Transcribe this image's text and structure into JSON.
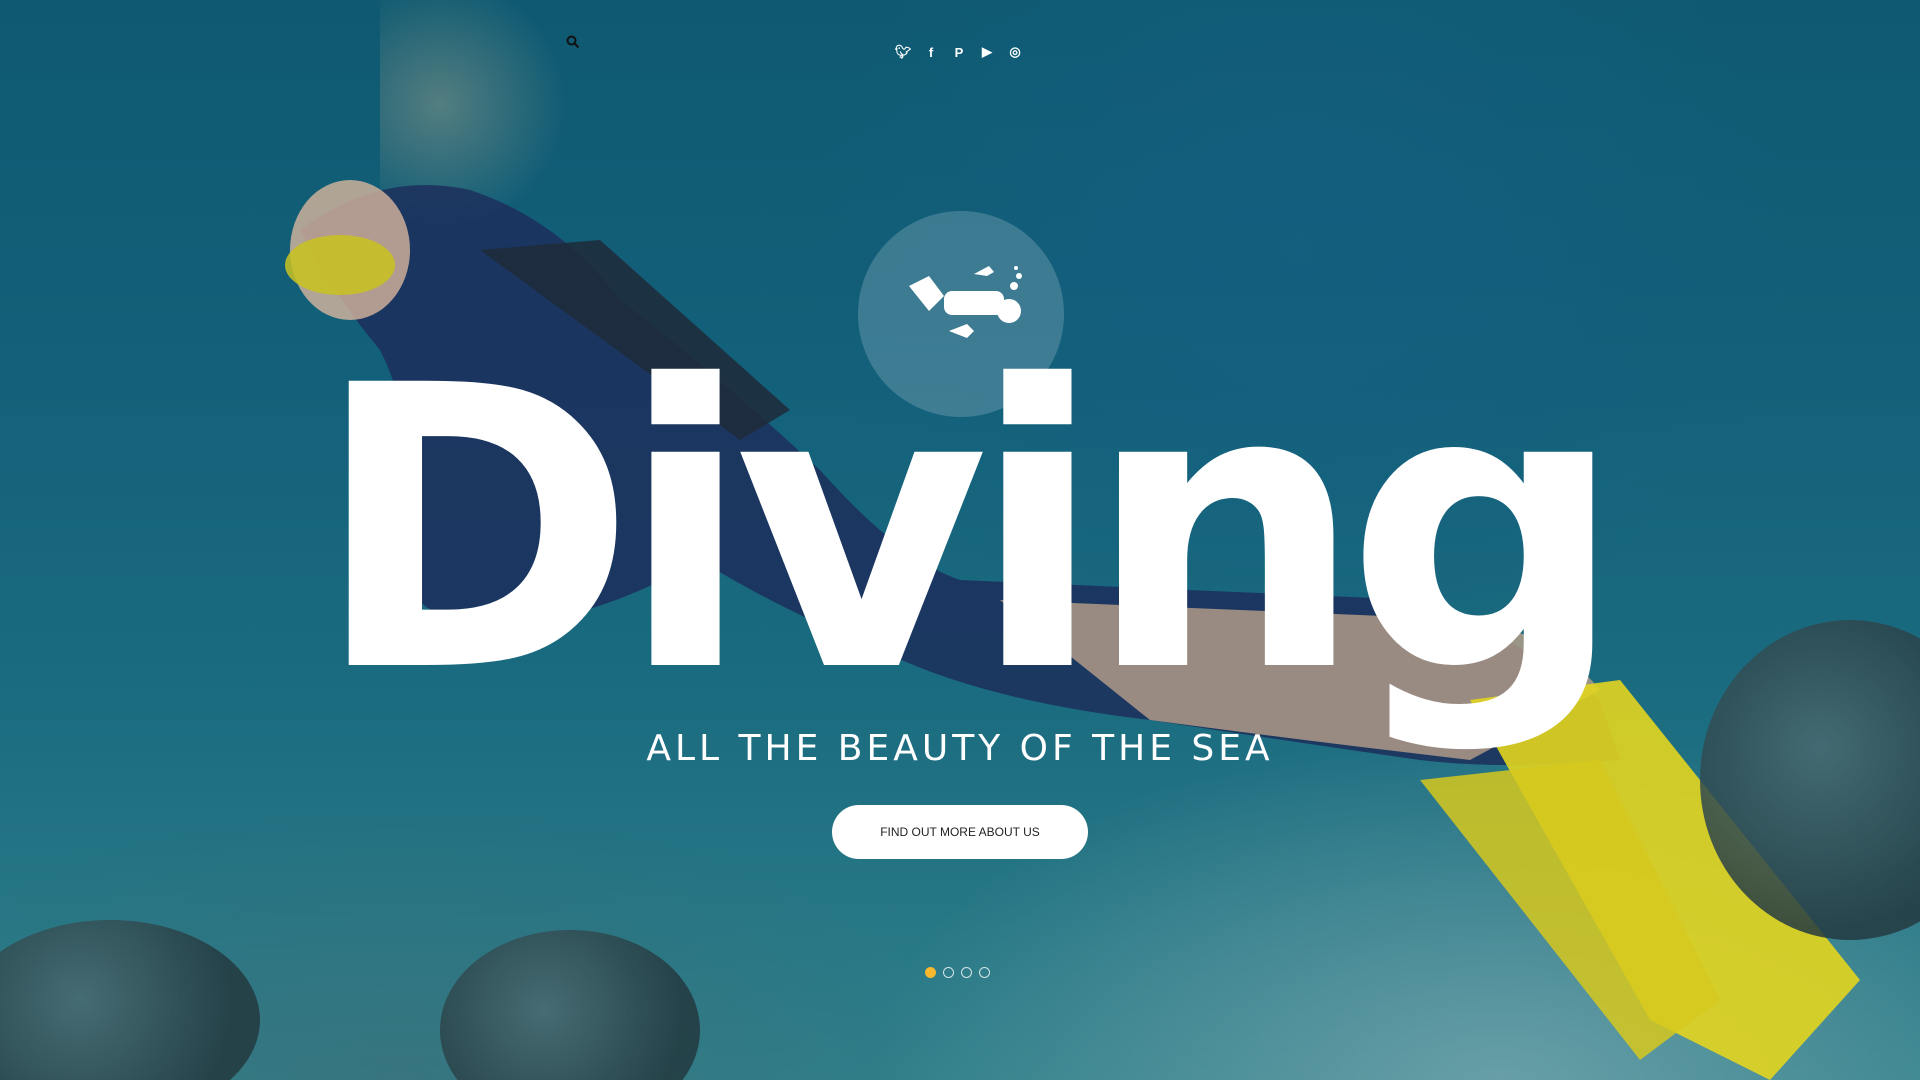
{
  "hero": {
    "headline": "Diving",
    "tagline": "ALL THE BEAUTY OF THE SEA",
    "cta_label": "FIND OUT MORE ABOUT US"
  },
  "social": [
    {
      "icon": "twitter-icon",
      "glyph": "🐦︎"
    },
    {
      "icon": "facebook-icon",
      "glyph": "f"
    },
    {
      "icon": "pinterest-icon",
      "glyph": "P"
    },
    {
      "icon": "youtube-icon",
      "glyph": "▶"
    },
    {
      "icon": "instagram-icon",
      "glyph": "◎"
    }
  ],
  "slider": {
    "count": 4,
    "active": 1
  },
  "colors": {
    "accent": "#f5b82e",
    "text": "#ffffff"
  }
}
